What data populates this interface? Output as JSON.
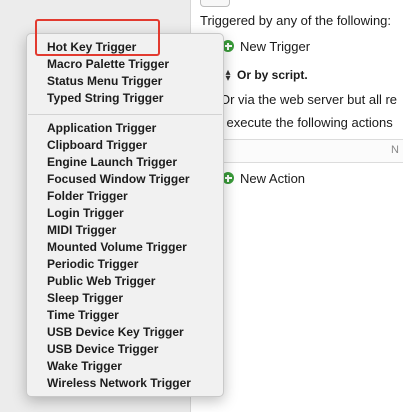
{
  "editor": {
    "triggered_label": "Triggered by any of the following:",
    "new_trigger_label": "New Trigger",
    "or_by_script_label": "Or by script.",
    "web_server_label": "Or via the web server but all re",
    "execute_label": "l execute the following actions",
    "table_header_cell": "N",
    "new_action_label": "New Action"
  },
  "trigger_menu": {
    "group1": [
      "Hot Key Trigger",
      "Macro Palette Trigger",
      "Status Menu Trigger",
      "Typed String Trigger"
    ],
    "group2": [
      "Application Trigger",
      "Clipboard Trigger",
      "Engine Launch Trigger",
      "Focused Window Trigger",
      "Folder Trigger",
      "Login Trigger",
      "MIDI Trigger",
      "Mounted Volume Trigger",
      "Periodic Trigger",
      "Public Web Trigger",
      "Sleep Trigger",
      "Time Trigger",
      "USB Device Key Trigger",
      "USB Device Trigger",
      "Wake Trigger",
      "Wireless Network Trigger"
    ]
  },
  "colors": {
    "highlight_border": "#e23a2f",
    "add_button": "#3a9b3a"
  }
}
